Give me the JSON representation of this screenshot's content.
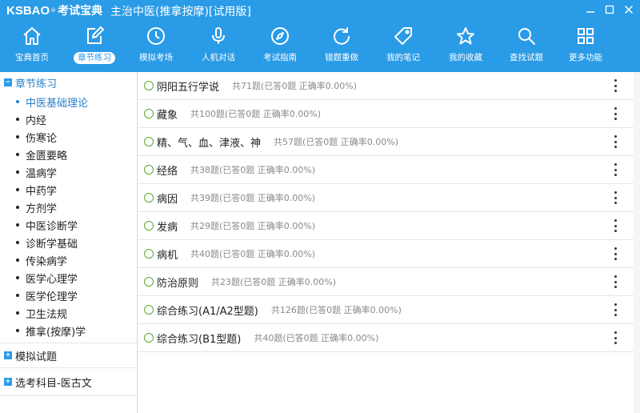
{
  "window": {
    "logo_latin": "KSBAO",
    "logo_mark": "®",
    "logo_cn": "考试宝典",
    "title": "主治中医(推拿按摩)[试用版]"
  },
  "toolbar": [
    {
      "label": "宝典首页",
      "icon": "home-icon"
    },
    {
      "label": "章节练习",
      "icon": "edit-icon",
      "active": true
    },
    {
      "label": "模拟考场",
      "icon": "clock-icon"
    },
    {
      "label": "人机对话",
      "icon": "microphone-icon"
    },
    {
      "label": "考试指南",
      "icon": "compass-icon"
    },
    {
      "label": "错题重做",
      "icon": "refresh-icon"
    },
    {
      "label": "我的笔记",
      "icon": "tag-icon"
    },
    {
      "label": "我的收藏",
      "icon": "star-icon"
    },
    {
      "label": "查找试题",
      "icon": "search-icon"
    },
    {
      "label": "更多功能",
      "icon": "grid-icon"
    }
  ],
  "sidebar": {
    "chapter_section": {
      "label": "章节练习",
      "items": [
        "中医基础理论",
        "内经",
        "伤寒论",
        "金匮要略",
        "温病学",
        "中药学",
        "方剂学",
        "中医诊断学",
        "诊断学基础",
        "传染病学",
        "医学心理学",
        "医学伦理学",
        "卫生法规",
        "推拿(按摩)学"
      ]
    },
    "mock_section": {
      "label": "模拟试题"
    },
    "elective_section": {
      "label": "选考科目-医古文"
    }
  },
  "chapters": [
    {
      "title": "阴阳五行学说",
      "stat": "共71题(已答0题  正确率0.00%)"
    },
    {
      "title": "藏象",
      "stat": "共100题(已答0题  正确率0.00%)"
    },
    {
      "title": "精、气、血、津液、神",
      "stat": "共57题(已答0题  正确率0.00%)"
    },
    {
      "title": "经络",
      "stat": "共38题(已答0题  正确率0.00%)"
    },
    {
      "title": "病因",
      "stat": "共39题(已答0题  正确率0.00%)"
    },
    {
      "title": "发病",
      "stat": "共29题(已答0题  正确率0.00%)"
    },
    {
      "title": "病机",
      "stat": "共40题(已答0题  正确率0.00%)"
    },
    {
      "title": "防治原则",
      "stat": "共23题(已答0题  正确率0.00%)"
    },
    {
      "title": "综合练习(A1/A2型题)",
      "stat": "共126题(已答0题  正确率0.00%)"
    },
    {
      "title": "综合练习(B1型题)",
      "stat": "共40题(已答0题  正确率0.00%)"
    }
  ],
  "colors": {
    "accent": "#2a9be6",
    "link": "#2a7fc9",
    "circle": "#5aa832"
  }
}
